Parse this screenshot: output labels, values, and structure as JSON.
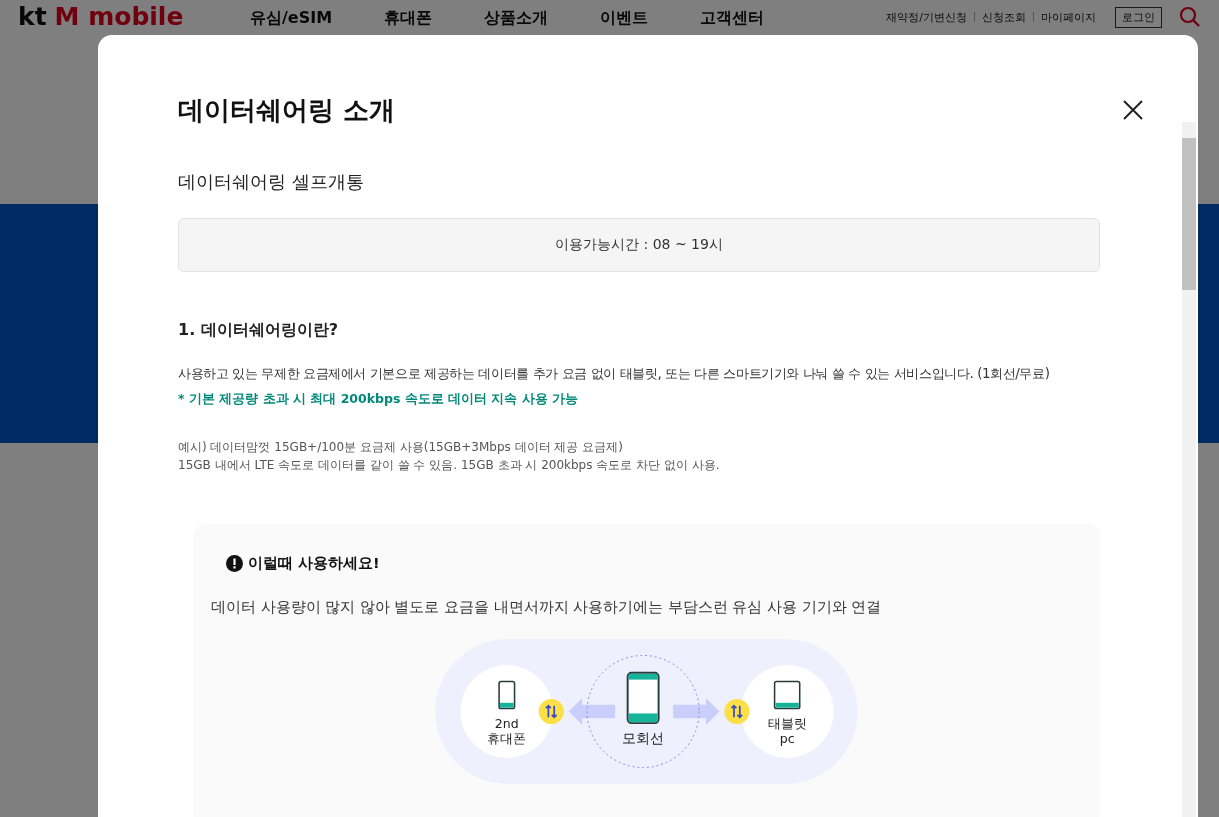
{
  "site_header": {
    "logo": {
      "brand": "kt",
      "product": "M mobile"
    },
    "nav": [
      "유심/eSIM",
      "휴대폰",
      "상품소개",
      "이벤트",
      "고객센터"
    ],
    "utility_links": [
      "재약정/기변신청",
      "신청조회",
      "마이페이지"
    ],
    "login_button": "로그인"
  },
  "modal": {
    "title": "데이터쉐어링 소개",
    "subtitle": "데이터쉐어링 셀프개통",
    "hours_notice": "이용가능시간 : 08 ~ 19시",
    "section_heading": "1. 데이터쉐어링이란?",
    "description": "사용하고 있는 무제한 요금제에서 기본으로 제공하는 데이터를 추가 요금 없이 태블릿, 또는 다른 스마트기기와 나눠 쓸 수 있는 서비스입니다. (1회선/무료)",
    "note": "*  기본 제공량 초과 시 최대 200kbps 속도로 데이터 지속 사용 가능",
    "example_lines": [
      "예시) 데이터맘껏 15GB+/100분 요금제 사용(15GB+3Mbps 데이터 제공 요금제)",
      "15GB 내에서 LTE 속도로 데이터를 같이 쓸 수 있음. 15GB 초과 시 200kbps 속도로 차단 없이 사용."
    ],
    "tip_card": {
      "heading": "이럴때 사용하세요!",
      "text": "데이터 사용량이 많지 않아 별도로 요금을 내면서까지 사용하기에는 부담스런 유심 사용 기기와 연결",
      "diagram_nodes": [
        {
          "kind": "phone",
          "label_lines": [
            "2nd",
            "휴대폰"
          ]
        },
        {
          "kind": "main",
          "label_lines": [
            "모회선"
          ]
        },
        {
          "kind": "tablet",
          "label_lines": [
            "태블릿",
            "pc"
          ]
        }
      ]
    }
  }
}
